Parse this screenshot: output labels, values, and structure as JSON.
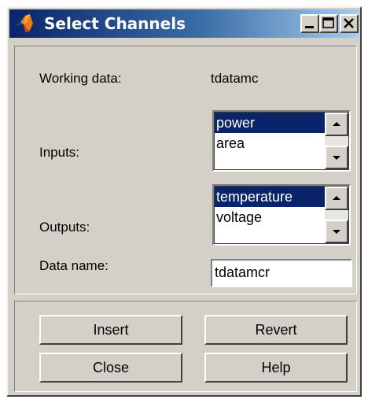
{
  "window": {
    "title": "Select Channels",
    "controls": {
      "minimize": "minimize-icon",
      "maximize": "maximize-icon",
      "close": "close-icon"
    }
  },
  "form": {
    "working_data_label": "Working data:",
    "working_data_value": "tdatamc",
    "inputs_label": "Inputs:",
    "inputs_items": [
      {
        "label": "power",
        "selected": true
      },
      {
        "label": "area",
        "selected": false
      }
    ],
    "outputs_label": "Outputs:",
    "outputs_items": [
      {
        "label": "temperature",
        "selected": true
      },
      {
        "label": "voltage",
        "selected": false
      }
    ],
    "data_name_label": "Data name:",
    "data_name_value": "tdatamcr"
  },
  "buttons": {
    "insert": "Insert",
    "revert": "Revert",
    "close": "Close",
    "help": "Help"
  },
  "colors": {
    "titlebar_start": "#0a246a",
    "titlebar_end": "#a6caf0",
    "selection": "#0a246a",
    "face": "#d4d0c8"
  }
}
